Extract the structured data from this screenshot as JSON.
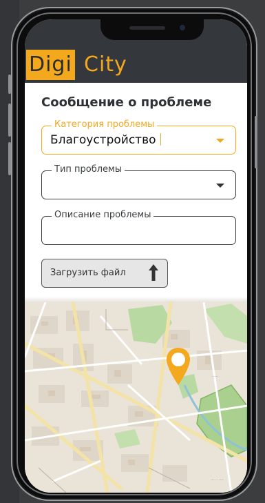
{
  "app": {
    "logo_part1": "Digi",
    "logo_part2": "City"
  },
  "form": {
    "title": "Сообщение о проблеме",
    "category": {
      "label": "Категория проблемы",
      "value": "Благоустройство"
    },
    "type": {
      "label": "Тип проблемы",
      "value": ""
    },
    "description": {
      "label": "Описание проблемы",
      "value": ""
    },
    "upload_label": "Загрузить файл"
  },
  "colors": {
    "accent": "#f4a81e",
    "header_bg": "#34383c",
    "map_green": "#b9d9a3"
  },
  "icons": {
    "dropdown": "chevron-down-icon",
    "upload": "arrow-up-icon",
    "location": "map-pin-icon"
  }
}
